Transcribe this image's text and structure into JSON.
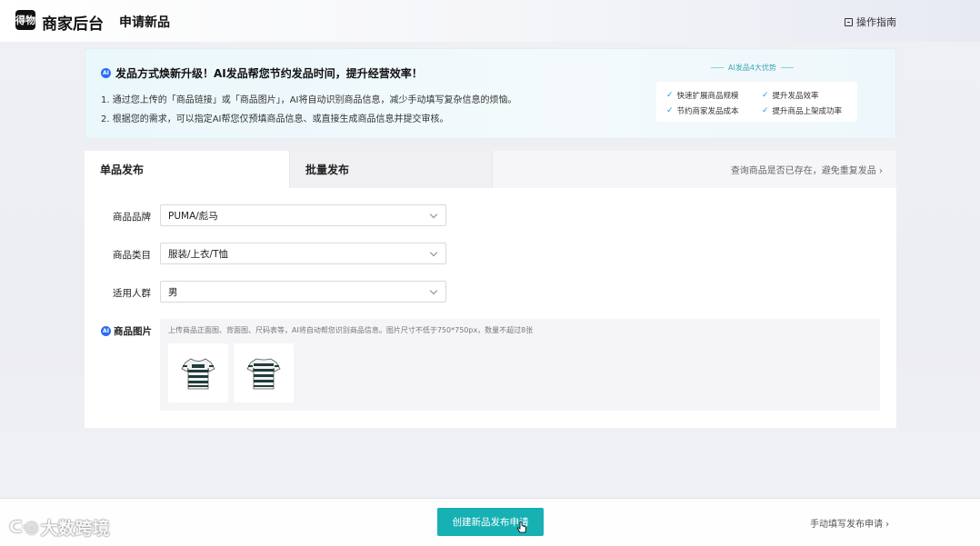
{
  "header": {
    "logo_text": "得物",
    "brand": "商家后台",
    "page_title": "申请新品",
    "guide_label": "操作指南"
  },
  "banner": {
    "ai_badge": "AI",
    "title": "发品方式焕新升级！AI发品帮您节约发品时间，提升经营效率！",
    "line1": "1. 通过您上传的「商品链接」或「商品图片」，AI将自动识别商品信息，减少手动填写复杂信息的烦恼。",
    "line2": "2. 根据您的需求，可以指定AI帮您仅预填商品信息、或直接生成商品信息并提交审核。",
    "advantages_title": "AI发品4大优势",
    "advantages": [
      "快速扩展商品规模",
      "提升发品效率",
      "节约商家发品成本",
      "提升商品上架成功率"
    ]
  },
  "tabs": {
    "single": "单品发布",
    "batch": "批量发布",
    "check_link": "查询商品是否已存在，避免重复发品 ›"
  },
  "form": {
    "brand_label": "商品品牌",
    "brand_value": "PUMA/彪马",
    "category_label": "商品类目",
    "category_value": "服装/上衣/T恤",
    "audience_label": "适用人群",
    "audience_value": "男",
    "images_label": "商品图片",
    "images_hint": "上传商品正面图、背面图、尺码表等，AI将自动帮您识别商品信息。图片尺寸不低于750*750px，数量不超过8张"
  },
  "footer": {
    "create_button": "创建新品发布申请",
    "manual_link": "手动填写发布申请 ›",
    "watermark": "大数跨境"
  },
  "colors": {
    "accent": "#17b0b3",
    "ai_blue": "#2a6df0",
    "check_blue": "#1e9bd6"
  }
}
